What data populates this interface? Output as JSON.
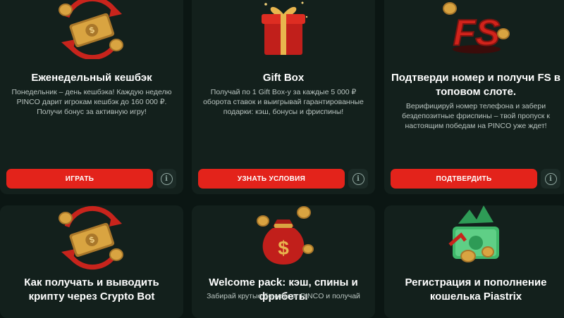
{
  "cards": [
    {
      "title": "Еженедельный кешбэк",
      "description": "Понедельник – день кешбэка! Каждую неделю PINCO дарит игрокам кешбэк до 160 000 ₽. Получи бонус за активную игру!",
      "button": "ИГРАТЬ",
      "icon": "cashback-icon"
    },
    {
      "title": "Gift Box",
      "description": "Получай по 1 Gift Box-у за каждые 5 000 ₽ оборота ставок и выигрывай гарантированные подарки: кэш, бонусы и фриспины!",
      "button": "УЗНАТЬ УСЛОВИЯ",
      "icon": "gift-box-icon"
    },
    {
      "title": "Подтверди номер и получи FS в топовом слоте.",
      "description": "Верифицируй номер телефона и забери бездепозитные фриспины – твой пропуск к настоящим победам на PINCO уже ждет!",
      "button": "ПОДТВЕРДИТЬ",
      "icon": "fs-icon",
      "icon_text": "FS"
    },
    {
      "title": "Как получать и выводить крипту через Crypto Bot",
      "icon": "cashback-icon"
    },
    {
      "title": "Welcome pack: кэш, спины и фрибеты",
      "description": "Забирай крутые бонусы от PINCO и получай",
      "icon": "money-bag-icon",
      "icon_text": "$"
    },
    {
      "title": "Регистрация и пополнение кошелька Piastrix",
      "icon": "wallet-money-icon"
    }
  ],
  "colors": {
    "background": "#0b1613",
    "card": "#13201c",
    "button": "#e3231b",
    "accent_gold": "#d9a441"
  }
}
